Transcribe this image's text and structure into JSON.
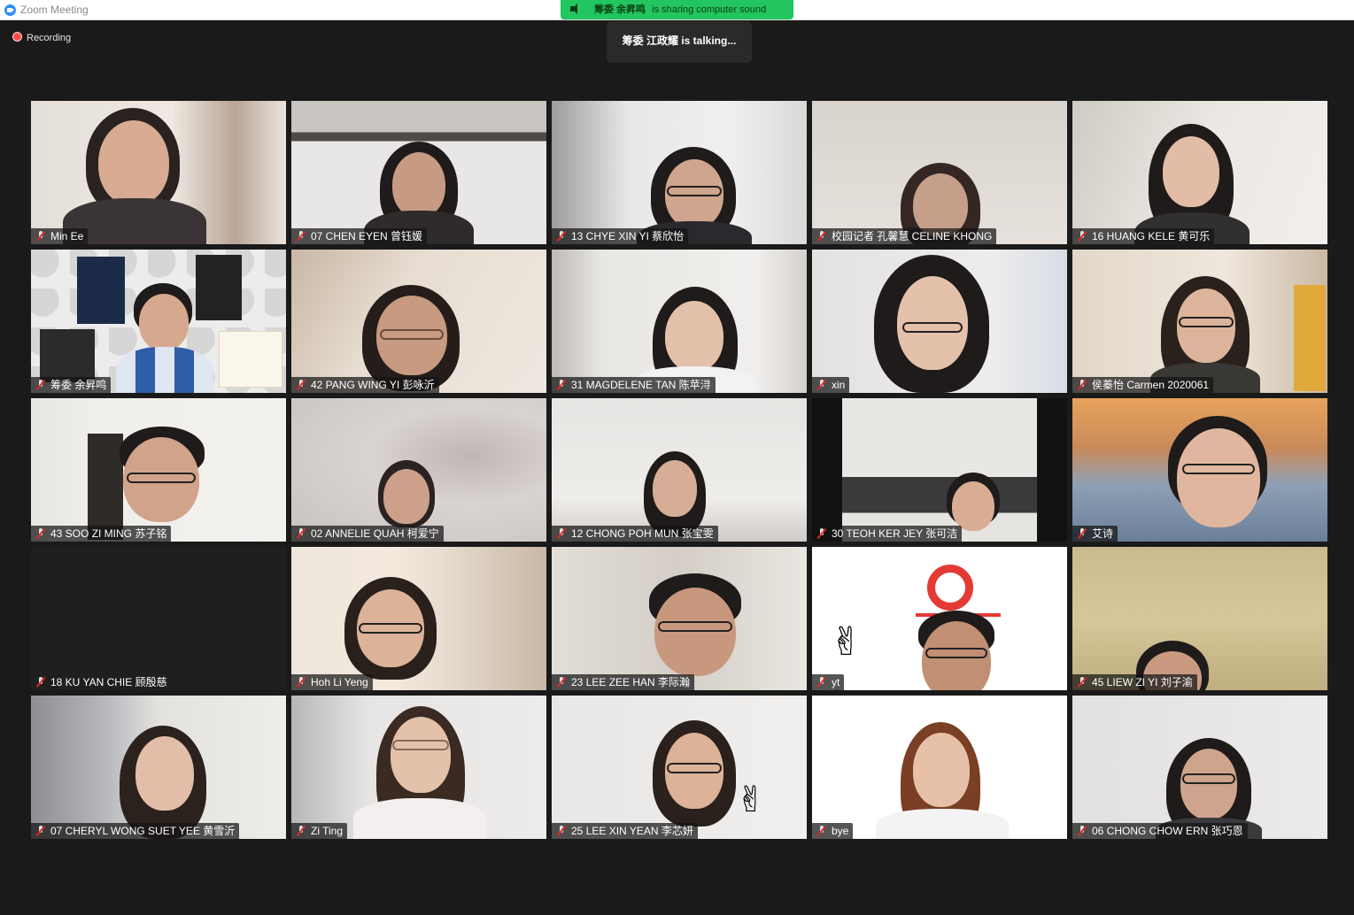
{
  "window": {
    "title": "Zoom Meeting"
  },
  "share_banner": {
    "sharer": "筹委 余昇鸣",
    "message": "is sharing computer sound"
  },
  "recording": {
    "label": "Recording"
  },
  "talking": {
    "text": "筹委 江政耀 is  talking..."
  },
  "participants": [
    {
      "name": "Min Ee",
      "muted": true
    },
    {
      "name": "07 CHEN EYEN 曾钰媛",
      "muted": true
    },
    {
      "name": "13 CHYE XIN YI 蔡欣怡",
      "muted": true
    },
    {
      "name": "校园记者 孔馨慧 CELINE KHONG",
      "muted": true
    },
    {
      "name": "16 HUANG KELE 黄可乐",
      "muted": true
    },
    {
      "name": "筹委 余昇鸣",
      "muted": true
    },
    {
      "name": "42 PANG WING YI 彭咏沂",
      "muted": true
    },
    {
      "name": "31 MAGDELENE TAN 陈苹浔",
      "muted": true
    },
    {
      "name": "xin",
      "muted": true
    },
    {
      "name": "侯蓁怡 Carmen 2020061",
      "muted": true
    },
    {
      "name": "43 SOO ZI MING 苏子铭",
      "muted": true
    },
    {
      "name": "02 ANNELIE QUAH 柯爱宁",
      "muted": true
    },
    {
      "name": "12 CHONG POH MUN  张宝雯",
      "muted": true
    },
    {
      "name": "30 TEOH KER JEY 张可洁",
      "muted": true
    },
    {
      "name": "艾诗",
      "muted": true
    },
    {
      "name": "18 KU YAN CHIE 顾殷慈",
      "muted": true
    },
    {
      "name": "Hoh Li Yeng",
      "muted": true
    },
    {
      "name": "23 LEE ZEE HAN 李际瀚",
      "muted": true
    },
    {
      "name": "yt",
      "muted": true
    },
    {
      "name": "45 LIEW ZI YI 刘子渝",
      "muted": true
    },
    {
      "name": "07 CHERYL WONG SUET YEE 黄雪沂",
      "muted": true
    },
    {
      "name": "Zi Ting",
      "muted": true
    },
    {
      "name": "25 LEE XIN YEAN 李芯妍",
      "muted": true
    },
    {
      "name": "bye",
      "muted": true
    },
    {
      "name": "06 CHONG CHOW ERN 张巧恩",
      "muted": true
    }
  ],
  "colors": {
    "background": "#1a1a1a",
    "share_banner": "#22c55e",
    "muted_icon": "#e02828"
  }
}
